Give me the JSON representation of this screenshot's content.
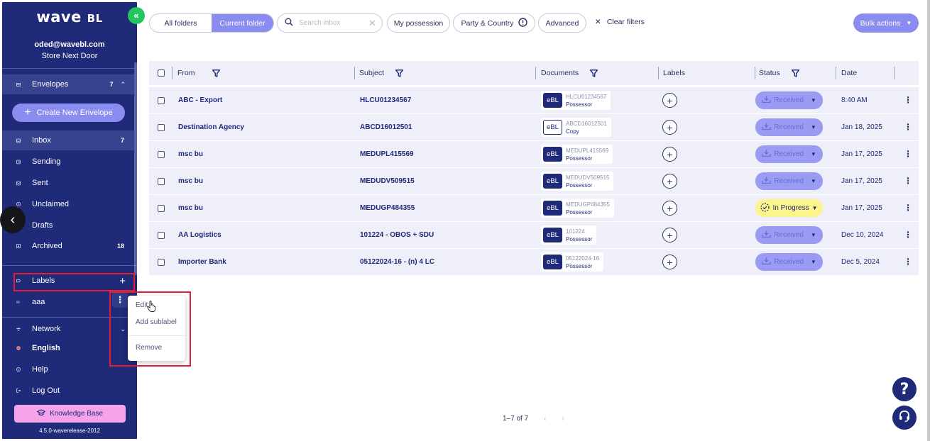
{
  "app": {
    "logo_main": "wave",
    "logo_bl": "BL",
    "collapse_glyph": "«",
    "back_glyph": "‹"
  },
  "account": {
    "email": "oded@wavebl.com",
    "company": "Store Next Door"
  },
  "sidebar": {
    "envelopes": {
      "label": "Envelopes",
      "count": "7",
      "icon": "envelope-icon"
    },
    "create_label": "Create New Envelope",
    "items": [
      {
        "label": "Inbox",
        "count": "7",
        "icon": "inbox-icon"
      },
      {
        "label": "Sending",
        "count": "",
        "icon": "sending-icon"
      },
      {
        "label": "Sent",
        "count": "",
        "icon": "sent-icon"
      },
      {
        "label": "Unclaimed",
        "count": "",
        "icon": "clock-icon"
      },
      {
        "label": "Drafts",
        "count": "",
        "icon": "drafts-icon"
      },
      {
        "label": "Archived",
        "count": "18",
        "icon": "archive-icon"
      }
    ],
    "labels": {
      "title": "Labels",
      "items": [
        {
          "name": "aaa"
        }
      ]
    },
    "bottom": {
      "network": "Network",
      "language": "English",
      "help": "Help",
      "logout": "Log Out"
    },
    "knowledge_base": "Knowledge Base",
    "version": "4.5.0-waverelease-2012"
  },
  "context_menu": {
    "edit": "Edit",
    "add_sublabel": "Add sublabel",
    "remove": "Remove"
  },
  "toolbar": {
    "all_folders": "All folders",
    "current_folder": "Current folder",
    "search_placeholder": "Search inbox",
    "my_possession": "My possession",
    "party_country": "Party & Country",
    "advanced": "Advanced",
    "clear_filters": "Clear filters",
    "bulk_actions": "Bulk actions"
  },
  "table": {
    "headers": {
      "from": "From",
      "subject": "Subject",
      "documents": "Documents",
      "labels": "Labels",
      "status": "Status",
      "date": "Date"
    },
    "rows": [
      {
        "from": "ABC - Export",
        "subject": "HLCU01234567",
        "doc_type": "eBL",
        "doc_number": "HLCU01234567",
        "doc_role": "Possessor",
        "status": "Received",
        "date": "8:40 AM"
      },
      {
        "from": "Destination Agency",
        "subject": "ABCD16012501",
        "doc_type": "eBL",
        "doc_number": "ABCD16012501",
        "doc_role": "Copy",
        "status": "Received",
        "date": "Jan 18, 2025"
      },
      {
        "from": "msc bu",
        "subject": "MEDUPL415569",
        "doc_type": "eBL",
        "doc_number": "MEDUPL415569",
        "doc_role": "Possessor",
        "status": "Received",
        "date": "Jan 17, 2025"
      },
      {
        "from": "msc bu",
        "subject": "MEDUDV509515",
        "doc_type": "eBL",
        "doc_number": "MEDUDV509515",
        "doc_role": "Possessor",
        "status": "Received",
        "date": "Jan 17, 2025"
      },
      {
        "from": "msc bu",
        "subject": "MEDUGP484355",
        "doc_type": "eBL",
        "doc_number": "MEDUGP484355",
        "doc_role": "Possessor",
        "status": "In Progress",
        "date": "Jan 17, 2025"
      },
      {
        "from": "AA Logistics",
        "subject": "101224 - OBOS + SDU",
        "doc_type": "eBL",
        "doc_number": "101224",
        "doc_role": "Possessor",
        "status": "Received",
        "date": "Dec 10, 2024"
      },
      {
        "from": "Importer Bank",
        "subject": "05122024-16 - (n) 4 LC",
        "doc_type": "eBL",
        "doc_number": "05122024-16",
        "doc_role": "Possessor",
        "status": "Received",
        "date": "Dec 5, 2024"
      }
    ]
  },
  "pagination": {
    "range": "1–7 of 7",
    "prev": "‹",
    "next": "›"
  },
  "colors": {
    "sidebar_bg": "#1f2a78",
    "accent": "#8b8cf0",
    "status_received": "#9a9bf2",
    "status_in_progress": "#fdf58c",
    "highlight_red": "#e01e37",
    "green": "#22c55e",
    "knowledge_pink": "#f5a3ea"
  }
}
